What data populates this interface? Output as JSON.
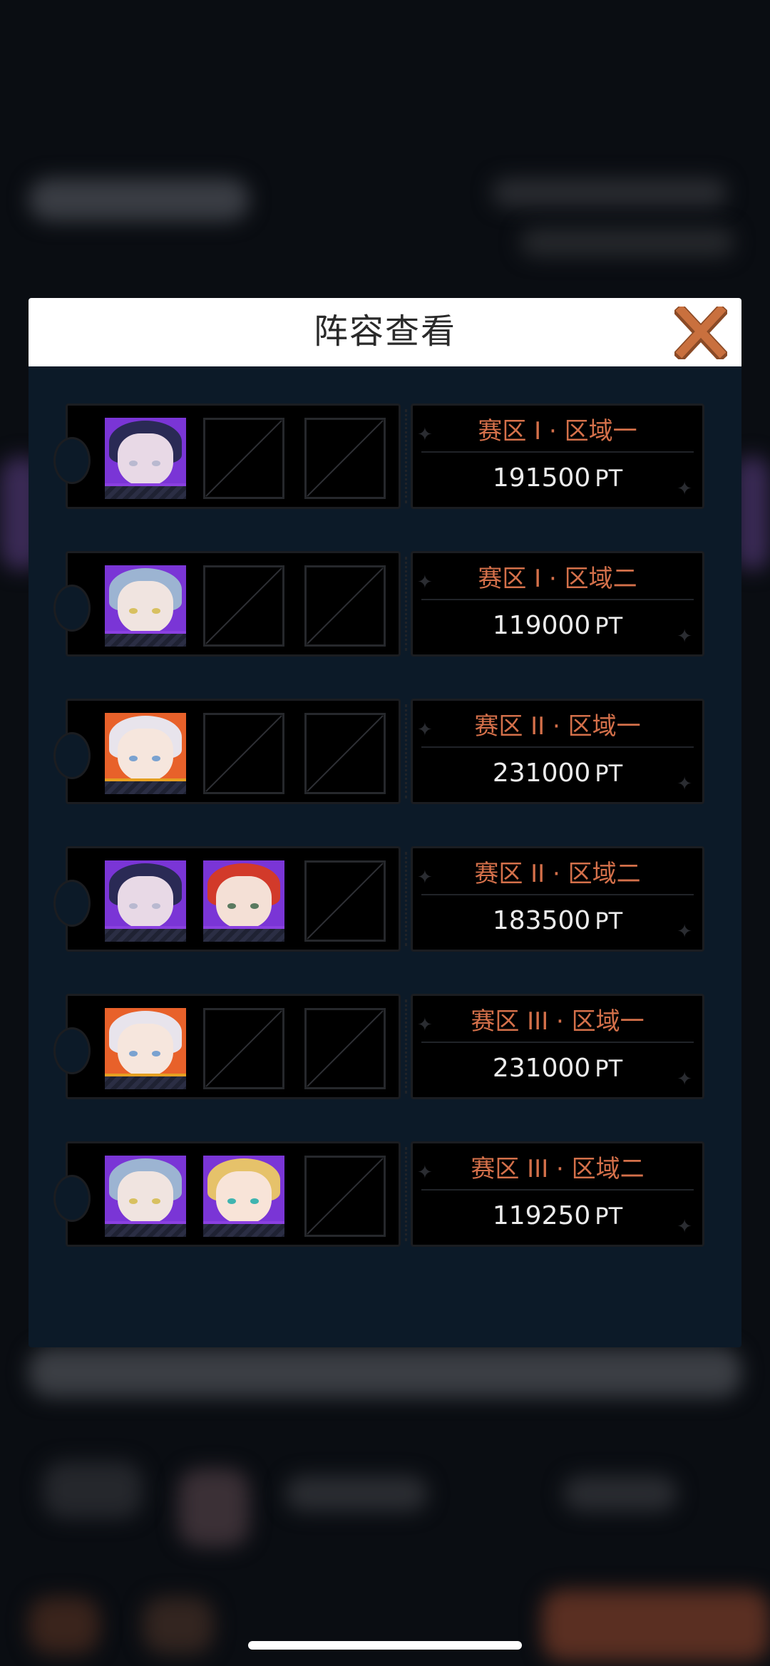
{
  "dialog": {
    "title": "阵容查看",
    "close_icon": "close-x-icon",
    "accent_color": "#d4704a"
  },
  "teams": [
    {
      "zone": "赛区 I · 区域一",
      "score": "191500",
      "unit": "PT",
      "slots": [
        {
          "filled": true,
          "avatar": "char-dark-hair-star-clip"
        },
        {
          "filled": false
        },
        {
          "filled": false
        }
      ]
    },
    {
      "zone": "赛区 I · 区域二",
      "score": "119000",
      "unit": "PT",
      "slots": [
        {
          "filled": true,
          "avatar": "char-silver-blue-hair"
        },
        {
          "filled": false
        },
        {
          "filled": false
        }
      ]
    },
    {
      "zone": "赛区 II · 区域一",
      "score": "231000",
      "unit": "PT",
      "slots": [
        {
          "filled": true,
          "avatar": "char-white-hair-heart-clip"
        },
        {
          "filled": false
        },
        {
          "filled": false
        }
      ]
    },
    {
      "zone": "赛区 II · 区域二",
      "score": "183500",
      "unit": "PT",
      "slots": [
        {
          "filled": true,
          "avatar": "char-dark-hair-star-clip"
        },
        {
          "filled": true,
          "avatar": "char-red-hair-goggles"
        },
        {
          "filled": false
        }
      ]
    },
    {
      "zone": "赛区 III · 区域一",
      "score": "231000",
      "unit": "PT",
      "slots": [
        {
          "filled": true,
          "avatar": "char-white-hair-heart-clip"
        },
        {
          "filled": false
        },
        {
          "filled": false
        }
      ]
    },
    {
      "zone": "赛区 III · 区域二",
      "score": "119250",
      "unit": "PT",
      "slots": [
        {
          "filled": true,
          "avatar": "char-silver-blue-hair"
        },
        {
          "filled": true,
          "avatar": "char-blonde-hair-cheerful"
        },
        {
          "filled": false
        }
      ]
    }
  ]
}
